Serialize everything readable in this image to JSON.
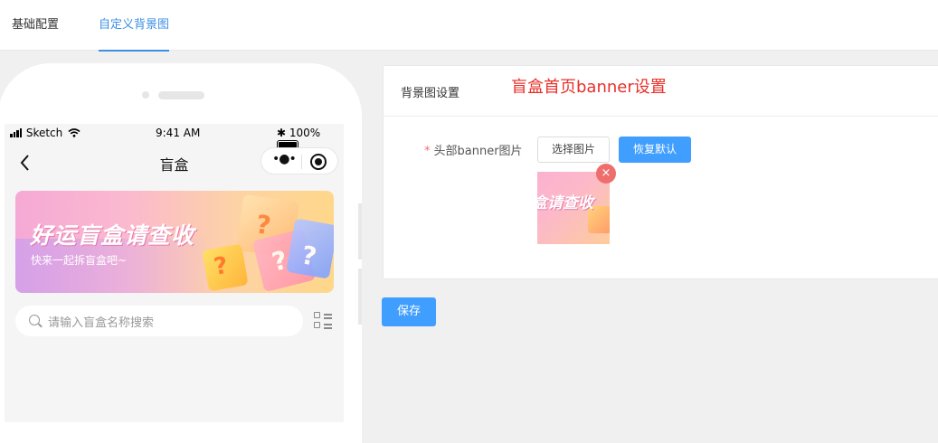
{
  "tabs": [
    {
      "label": "基础配置",
      "active": false
    },
    {
      "label": "自定义背景图",
      "active": true
    }
  ],
  "phone": {
    "status": {
      "carrier": "Sketch",
      "time": "9:41 AM",
      "battery": "100%"
    },
    "nav_title": "盲盒",
    "banner": {
      "title": "好运盲盒请查收",
      "subtitle": "快来一起拆盲盒吧~"
    },
    "search_placeholder": "请输入盲盒名称搜索",
    "icons": [
      "back-chevron-icon",
      "more-dots-icon",
      "target-icon",
      "search-icon",
      "grid-list-icon",
      "wifi-icon",
      "bluetooth-icon",
      "battery-icon"
    ]
  },
  "card": {
    "title": "背景图设置",
    "annotation": "盲盒首页banner设置",
    "field_required_mark": "*",
    "field_label": "头部banner图片",
    "choose_button": "选择图片",
    "reset_button": "恢复默认",
    "remove_icon": "×",
    "thumb_text": "盒请查收"
  },
  "save_button": "保存",
  "colors": {
    "accent": "#409eff",
    "tab_active": "#3c8fe4",
    "annotation": "#e8302a",
    "remove": "#ee6e6e"
  }
}
